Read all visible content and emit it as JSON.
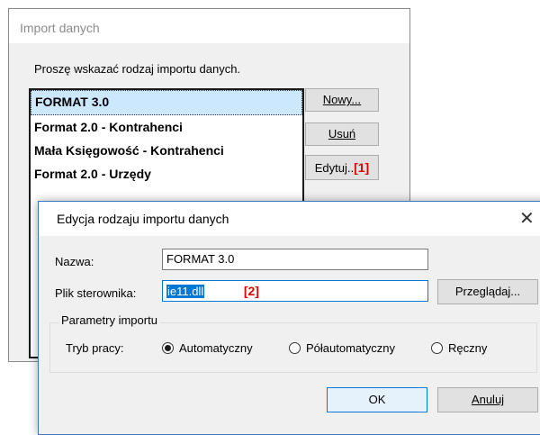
{
  "back_dialog": {
    "title": "Import danych",
    "prompt": "Proszę wskazać rodzaj importu danych.",
    "items": [
      "FORMAT 3.0",
      "Format 2.0 - Kontrahenci",
      "Mała Księgowość - Kontrahenci",
      "Format 2.0 - Urzędy"
    ],
    "selected_index": 0,
    "buttons": {
      "new_label": "Nowy...",
      "delete_label": "Usuń",
      "edit_label": "Edytuj..",
      "edit_marker": "[1]"
    }
  },
  "edit_dialog": {
    "title": "Edycja rodzaju importu danych",
    "name_label": "Nazwa:",
    "name_value": "FORMAT 3.0",
    "driver_label": "Plik sterownika:",
    "driver_value": "ie11.dll",
    "driver_marker": "[2]",
    "browse_label": "Przeglądaj...",
    "params_group_title": "Parametry importu",
    "mode_label": "Tryb pracy:",
    "modes": [
      "Automatyczny",
      "Półautomatyczny",
      "Ręczny"
    ],
    "selected_mode": "Automatyczny",
    "ok_label": "OK",
    "cancel_label": "Anuluj",
    "close_icon": "close-icon"
  }
}
